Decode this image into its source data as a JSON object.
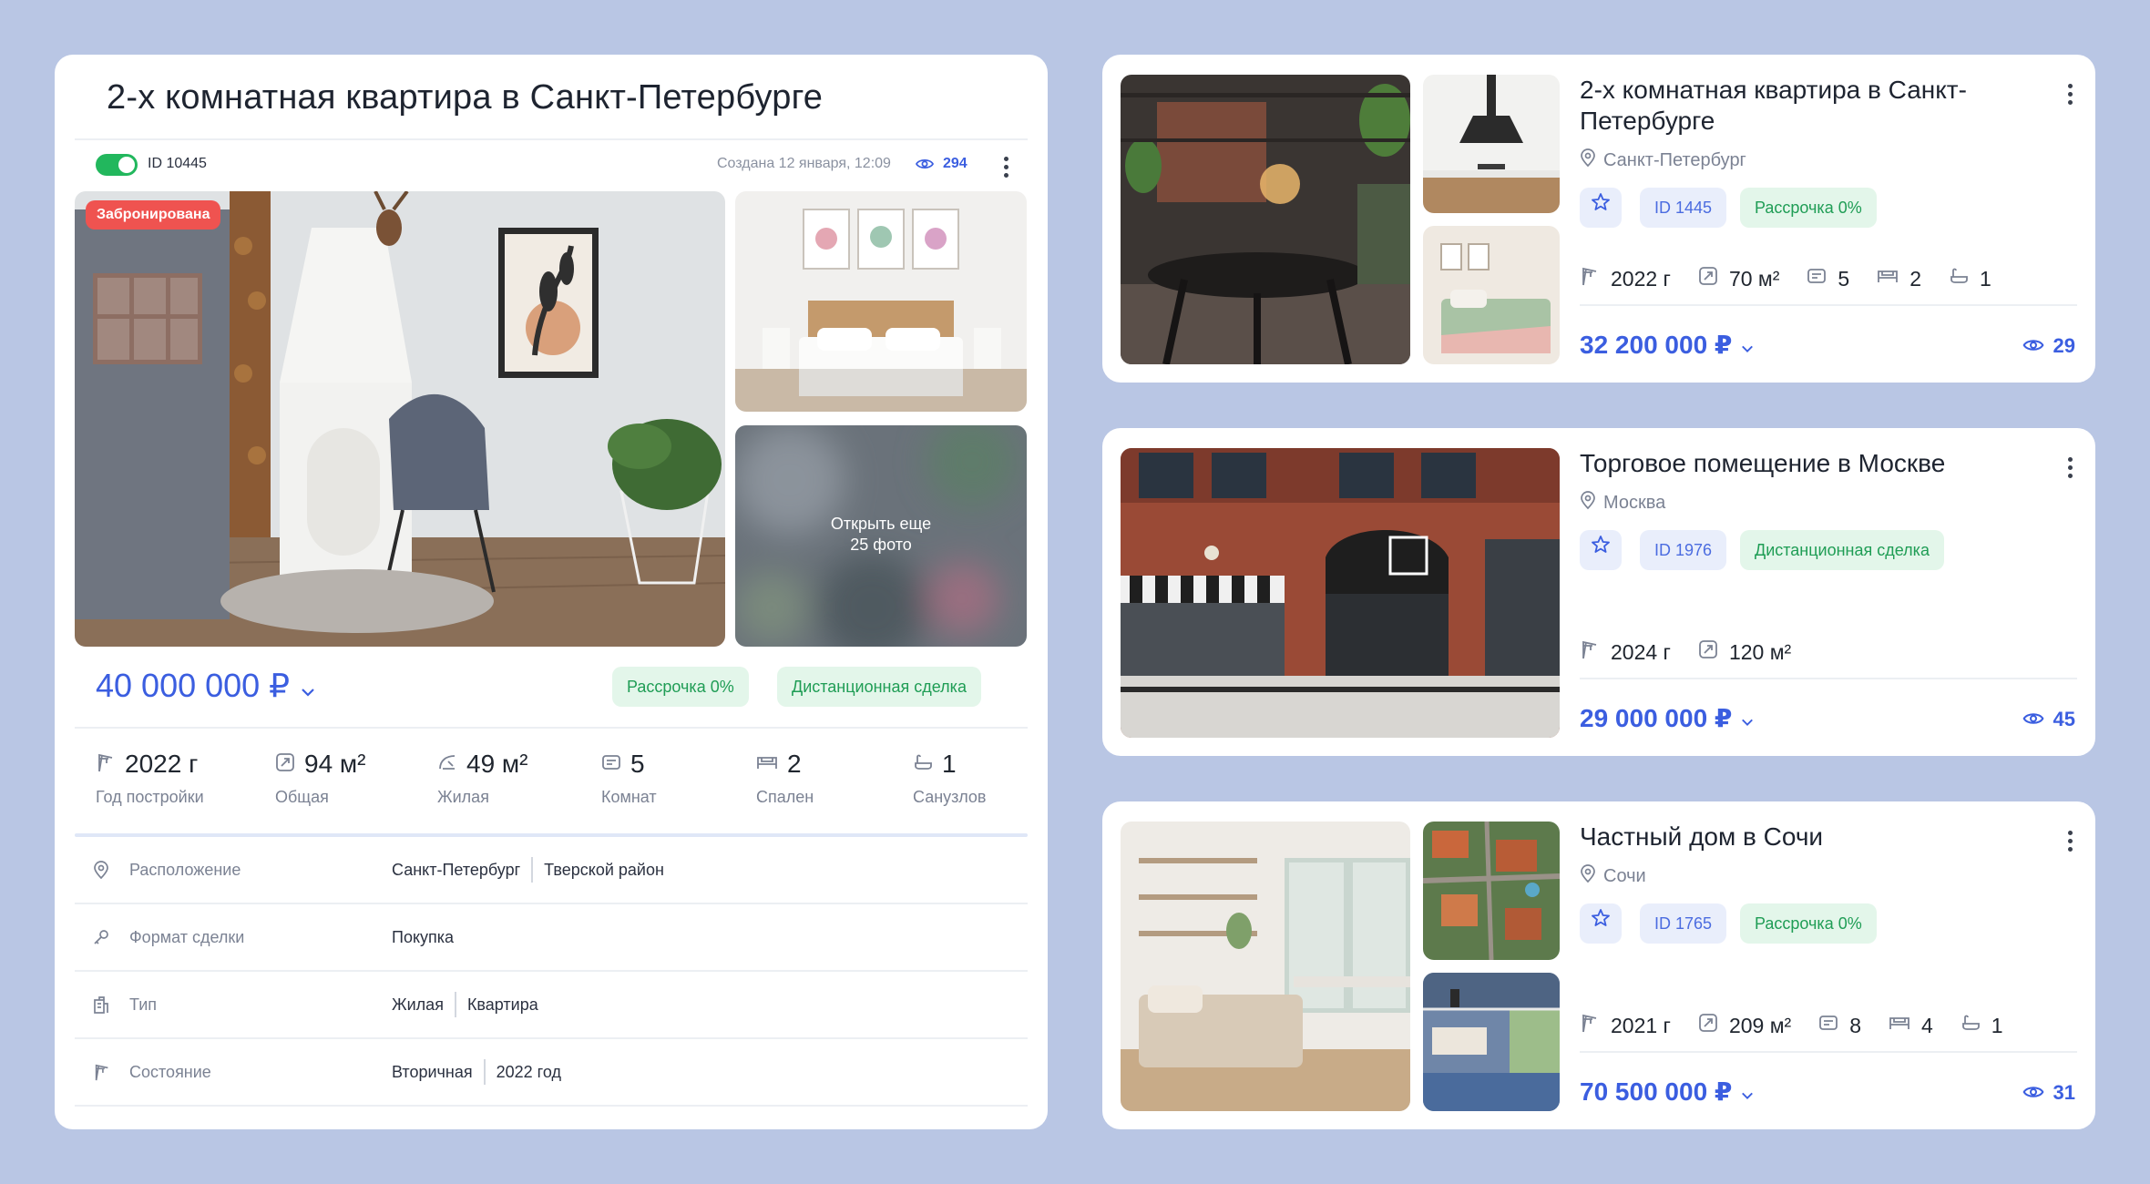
{
  "detail": {
    "title": "2-х комнатная квартира в Санкт-Петербурге",
    "id_label": "ID 10445",
    "created": "Создана 12 января, 12:09",
    "views": "294",
    "badge": "Забронирована",
    "more_photos_line1": "Открыть еще",
    "more_photos_line2": "25 фото",
    "price": "40 000 000 ₽",
    "chips": [
      "Рассрочка 0%",
      "Дистанционная сделка"
    ],
    "stats": [
      {
        "value": "2022 г",
        "label": "Год постройки",
        "icon": "crane-icon"
      },
      {
        "value": "94 м²",
        "label": "Общая",
        "icon": "area-icon"
      },
      {
        "value": "49 м²",
        "label": "Жилая",
        "icon": "living-area-icon"
      },
      {
        "value": "5",
        "label": "Комнат",
        "icon": "rooms-icon"
      },
      {
        "value": "2",
        "label": "Спален",
        "icon": "bed-icon"
      },
      {
        "value": "1",
        "label": "Санузлов",
        "icon": "bath-icon"
      }
    ],
    "info": [
      {
        "key": "Расположение",
        "values": [
          "Санкт-Петербург",
          "Тверской район"
        ],
        "icon": "location-icon"
      },
      {
        "key": "Формат сделки",
        "values": [
          "Покупка"
        ],
        "icon": "key-icon"
      },
      {
        "key": "Тип",
        "values": [
          "Жилая",
          "Квартира"
        ],
        "icon": "building-icon"
      },
      {
        "key": "Состояние",
        "values": [
          "Вторичная",
          "2022 год"
        ],
        "icon": "crane-icon"
      }
    ]
  },
  "listings": [
    {
      "title": "2-х комнатная квартира в Санкт-Петербурге",
      "location": "Санкт-Петербург",
      "id_label": "ID 1445",
      "chip": "Рассрочка 0%",
      "stats": {
        "year": "2022 г",
        "area": "70 м²",
        "rooms": "5",
        "beds": "2",
        "baths": "1"
      },
      "price": "32 200 000 ₽",
      "views": "29"
    },
    {
      "title": "Торговое помещение в Москве",
      "location": "Москва",
      "id_label": "ID 1976",
      "chip": "Дистанционная сделка",
      "stats": {
        "year": "2024 г",
        "area": "120 м²"
      },
      "price": "29 000 000 ₽",
      "views": "45"
    },
    {
      "title": "Частный дом в Сочи",
      "location": "Сочи",
      "id_label": "ID 1765",
      "chip": "Рассрочка 0%",
      "stats": {
        "year": "2021 г",
        "area": "209 м²",
        "rooms": "8",
        "beds": "4",
        "baths": "1"
      },
      "price": "70 500 000 ₽",
      "views": "31"
    }
  ],
  "colors": {
    "accent": "#3b5ee0",
    "green": "#22b75d",
    "badge_red": "#ef5350",
    "background": "#b9c6e4"
  }
}
